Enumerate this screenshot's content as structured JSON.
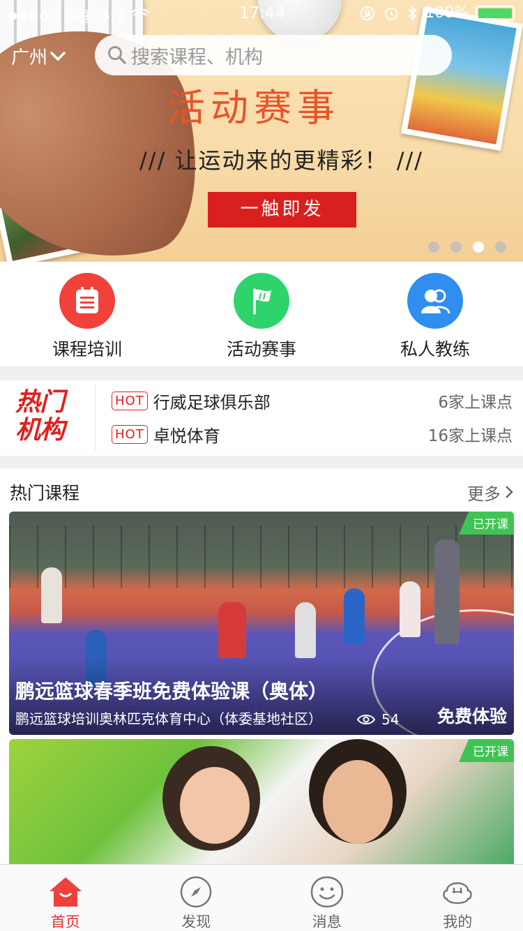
{
  "status_bar": {
    "carrier": "中国移动",
    "time": "17:44",
    "battery": "100%"
  },
  "header": {
    "city": "广州",
    "search_placeholder": "搜索课程、机构"
  },
  "banner": {
    "title": "活动赛事",
    "subtitle": "/// 让运动来的更精彩！ ///",
    "button_label": "一触即发",
    "page_count": 4,
    "active_page": 3
  },
  "entries": [
    {
      "label": "课程培训",
      "icon": "list-icon",
      "color": "#f2403a"
    },
    {
      "label": "活动赛事",
      "icon": "flag-icon",
      "color": "#2ed36b"
    },
    {
      "label": "私人教练",
      "icon": "coach-icon",
      "color": "#2f8ef0"
    }
  ],
  "hot_orgs": {
    "logo_line1": "热门",
    "logo_line2": "机构",
    "items": [
      {
        "tag": "HOT",
        "name": "行威足球俱乐部",
        "count": "6家上课点"
      },
      {
        "tag": "HOT",
        "name": "卓悦体育",
        "count": "16家上课点"
      }
    ]
  },
  "courses": {
    "title": "热门课程",
    "more_label": "更多",
    "items": [
      {
        "badge": "已开课",
        "title": "鹏远篮球春季班免费体验课（奥体）",
        "subtitle": "鹏远篮球培训奥林匹克体育中心（体委基地社区）",
        "views": "54",
        "price_label": "免费体验"
      },
      {
        "badge": "已开课"
      }
    ]
  },
  "tabbar": {
    "items": [
      {
        "label": "首页",
        "icon": "home-icon",
        "active": true
      },
      {
        "label": "发现",
        "icon": "compass-icon",
        "active": false
      },
      {
        "label": "消息",
        "icon": "smiley-icon",
        "active": false
      },
      {
        "label": "我的",
        "icon": "profile-icon",
        "active": false
      }
    ]
  },
  "colors": {
    "brand_red": "#e5302f",
    "badge_green": "#3fc454"
  }
}
